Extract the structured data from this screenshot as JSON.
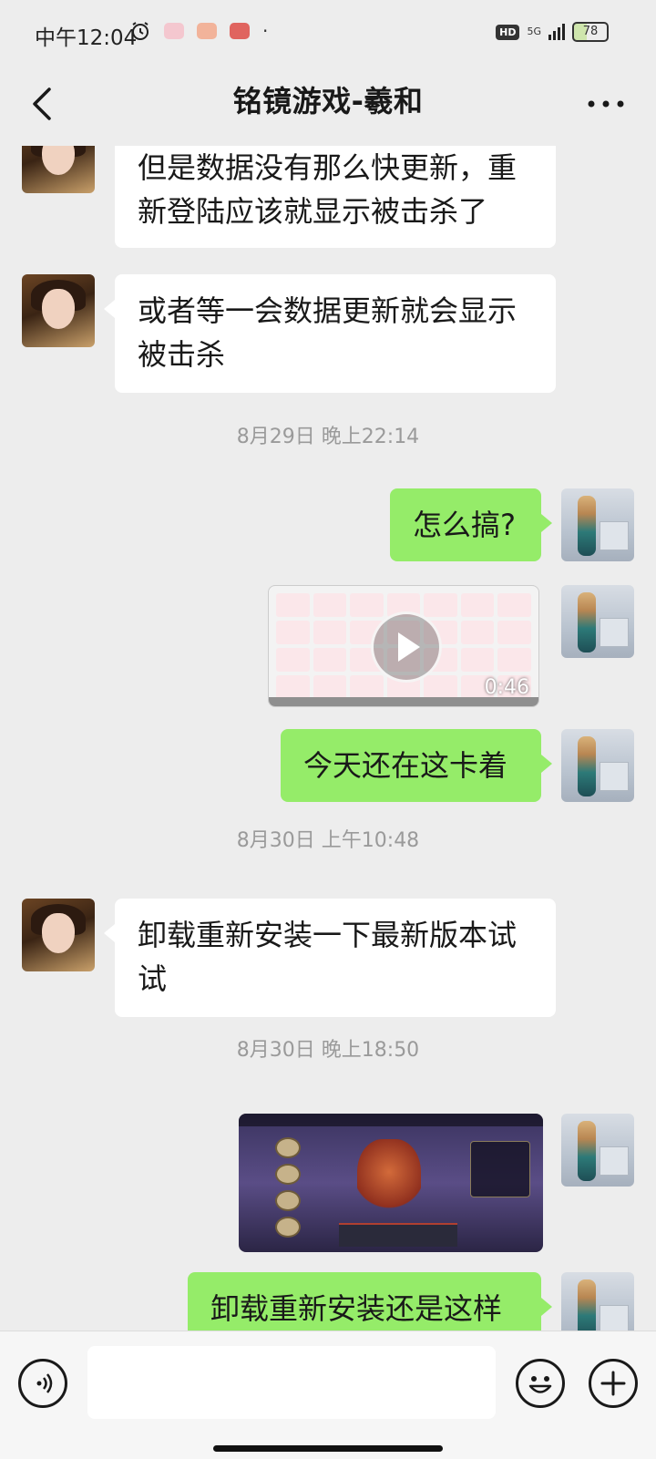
{
  "status_bar": {
    "time": "中午12:04",
    "network": "5G",
    "hd": "HD",
    "battery": "78"
  },
  "header": {
    "title": "铭镜游戏-羲和",
    "back_icon": "chevron-left-icon",
    "more_icon": "more-dots-icon"
  },
  "messages": [
    {
      "side": "left",
      "type": "text",
      "text": "但是数据没有那么快更新，重新登陆应该就显示被击杀了"
    },
    {
      "side": "left",
      "type": "text",
      "text": "或者等一会数据更新就会显示被击杀"
    },
    {
      "type": "timestamp",
      "text": "8月29日 晚上22:14"
    },
    {
      "side": "right",
      "type": "text",
      "text": "怎么搞?"
    },
    {
      "side": "right",
      "type": "video",
      "duration": "0:46"
    },
    {
      "side": "right",
      "type": "text",
      "text": "今天还在这卡着"
    },
    {
      "type": "timestamp",
      "text": "8月30日 上午10:48"
    },
    {
      "side": "left",
      "type": "text",
      "text": "卸载重新安装一下最新版本试试"
    },
    {
      "type": "timestamp",
      "text": "8月30日 晚上18:50"
    },
    {
      "side": "right",
      "type": "image",
      "description": "game-screenshot"
    },
    {
      "side": "right",
      "type": "text",
      "text": "卸载重新安装还是这样"
    }
  ],
  "input_bar": {
    "voice_icon": "voice-icon",
    "emoji_icon": "emoji-icon",
    "plus_icon": "plus-icon",
    "text_value": ""
  },
  "colors": {
    "background": "#ededed",
    "bubble_self": "#95ec69",
    "bubble_other": "#ffffff",
    "timestamp": "#9a9a9a"
  }
}
